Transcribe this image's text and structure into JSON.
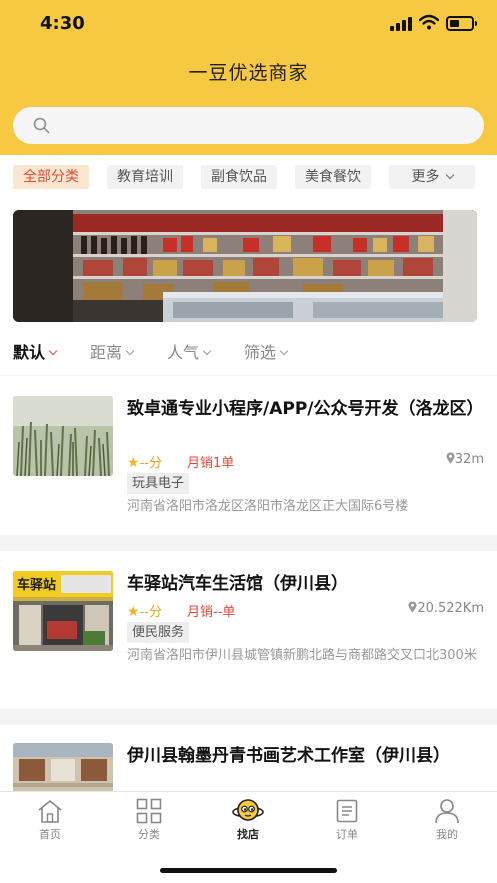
{
  "status": {
    "time": "4:30"
  },
  "header": {
    "title": "一豆优选商家",
    "search_placeholder": ""
  },
  "categories": [
    "全部分类",
    "教育培训",
    "副食饮品",
    "美食餐饮",
    "更多"
  ],
  "sorts": [
    "默认",
    "距离",
    "人气",
    "筛选"
  ],
  "shops": [
    {
      "name": "致卓通专业小程序/APP/公众号开发（洛龙区）",
      "rating": "--分",
      "sales": "月销1单",
      "distance": "32m",
      "tag": "玩具电子",
      "address": "河南省洛阳市洛龙区洛阳市洛龙区正大国际6号楼"
    },
    {
      "name": "车驿站汽车生活馆（伊川县）",
      "rating": "--分",
      "sales": "月销--单",
      "distance": "20.522Km",
      "tag": "便民服务",
      "address": "河南省洛阳市伊川县城管镇新鹏北路与商都路交叉口北300米",
      "thumb_sign": "车驿站"
    },
    {
      "name": "伊川县翰墨丹青书画艺术工作室（伊川县）"
    }
  ],
  "tabbar": [
    "首页",
    "分类",
    "找店",
    "订单",
    "我的"
  ],
  "colors": {
    "brand": "#f7c841",
    "accent": "#e2493b",
    "star": "#f5b427"
  }
}
